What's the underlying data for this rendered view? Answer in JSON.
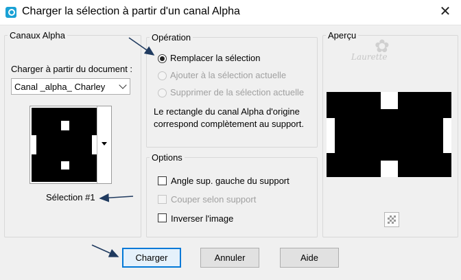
{
  "window": {
    "title": "Charger la sélection à partir d'un canal Alpha",
    "close_glyph": "✕"
  },
  "alpha_channels": {
    "legend": "Canaux Alpha",
    "load_from_label": "Charger à partir du document :",
    "document_select": {
      "selected": "Canal _alpha_ Charley"
    },
    "selection_name": "Sélection #1"
  },
  "operation": {
    "legend": "Opération",
    "options": [
      {
        "label": "Remplacer la sélection",
        "checked": true,
        "enabled": true
      },
      {
        "label": "Ajouter à la sélection actuelle",
        "checked": false,
        "enabled": false
      },
      {
        "label": "Supprimer de la sélection actuelle",
        "checked": false,
        "enabled": false
      }
    ],
    "description": "Le rectangle du canal Alpha d'origine correspond complètement au support."
  },
  "options": {
    "legend": "Options",
    "checkboxes": [
      {
        "label": "Angle sup. gauche du support",
        "checked": false,
        "enabled": true
      },
      {
        "label": "Couper selon support",
        "checked": false,
        "enabled": false
      },
      {
        "label": "Inverser l'image",
        "checked": false,
        "enabled": true
      }
    ]
  },
  "preview": {
    "legend": "Aperçu",
    "watermark": "Laurette"
  },
  "buttons": {
    "load": "Charger",
    "cancel": "Annuler",
    "help": "Aide"
  },
  "colors": {
    "accent": "#0078d7",
    "dialog_bg": "#f0f0f0",
    "arrow": "#1f3a5f"
  }
}
